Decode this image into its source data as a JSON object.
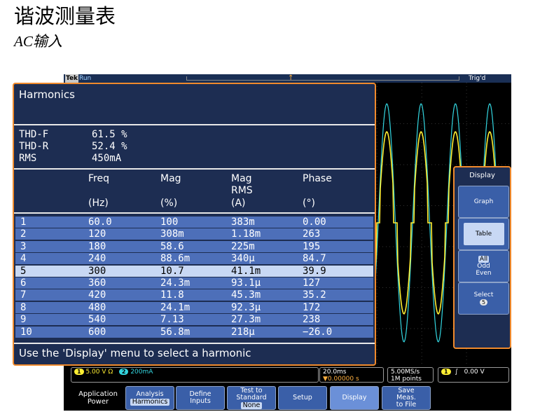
{
  "page": {
    "title": "谐波测量表",
    "subtitle": "AC输入"
  },
  "status": {
    "brand": "Tek",
    "state": "Run",
    "trigger_marker": "↑",
    "trigger_state": "Trig'd"
  },
  "panel": {
    "title": "Harmonics",
    "summary": [
      {
        "label": "THD-F",
        "value": "61.5 %"
      },
      {
        "label": "THD-R",
        "value": "52.4 %"
      },
      {
        "label": "RMS",
        "value": "450mA"
      }
    ],
    "columns": [
      {
        "label": "",
        "label2": "",
        "unit": ""
      },
      {
        "label": "Freq",
        "label2": "",
        "unit": "(Hz)"
      },
      {
        "label": "Mag",
        "label2": "",
        "unit": "(%)"
      },
      {
        "label": "Mag",
        "label2": "RMS",
        "unit": "(A)"
      },
      {
        "label": "Phase",
        "label2": "",
        "unit": "(°)"
      }
    ],
    "rows": [
      [
        "1",
        "60.0",
        "100",
        "383m",
        "0.00"
      ],
      [
        "2",
        "120",
        "308m",
        "1.18m",
        "263"
      ],
      [
        "3",
        "180",
        "58.6",
        "225m",
        "195"
      ],
      [
        "4",
        "240",
        "88.6m",
        "340µ",
        "84.7"
      ],
      [
        "5",
        "300",
        "10.7",
        "41.1m",
        "39.9"
      ],
      [
        "6",
        "360",
        "24.3m",
        "93.1µ",
        "127"
      ],
      [
        "7",
        "420",
        "11.8",
        "45.3m",
        "35.2"
      ],
      [
        "8",
        "480",
        "24.1m",
        "92.3µ",
        "172"
      ],
      [
        "9",
        "540",
        "7.13",
        "27.3m",
        "238"
      ],
      [
        "10",
        "600",
        "56.8m",
        "218µ",
        "−26.0"
      ]
    ],
    "selected_row": 5,
    "footer": "Use the 'Display' menu to select a harmonic"
  },
  "side_menu": {
    "title": "Display",
    "graph": "Graph",
    "table": "Table",
    "filter_all": "All",
    "filter_odd": "Odd",
    "filter_even": "Even",
    "select_label": "Select",
    "select_value": "5"
  },
  "readout": {
    "ch1": "1",
    "ch1_scale": "5.00 V",
    "ch1_unit": "Ω",
    "ch2": "2",
    "ch2_scale": "200mA",
    "timebase": "20.0ms",
    "offset": "▼0.00000 s",
    "sample_rate": "5.00MS/s",
    "record": "1M points",
    "trig_ch": "1",
    "trig_slope": "∫",
    "trig_level": "0.00 V"
  },
  "bottom_menu": {
    "app_line1": "Application",
    "app_line2": "Power",
    "analysis": "Analysis",
    "analysis_sub": "Harmonics",
    "define_inputs_1": "Define",
    "define_inputs_2": "Inputs",
    "test_1": "Test to",
    "test_2": "Standard",
    "test_sub": "None",
    "setup": "Setup",
    "display": "Display",
    "save_1": "Save",
    "save_2": "Meas.",
    "save_3": "to File"
  },
  "colors": {
    "panel_bg": "#1d2d52",
    "row_bg": "#4d6fb9",
    "row_selected": "#c8d8f4",
    "accent_border": "#f08a2c",
    "ch1": "#ffee33",
    "ch2": "#33d6e0"
  }
}
